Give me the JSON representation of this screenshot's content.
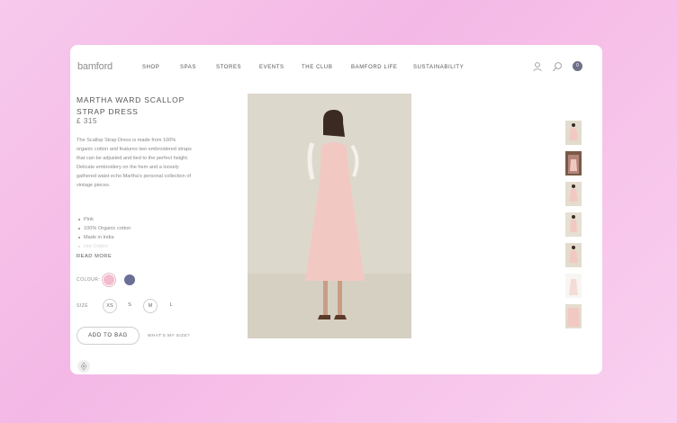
{
  "header": {
    "logo": "bamford",
    "nav": [
      "SHOP",
      "SPAS",
      "STORES",
      "EVENTS",
      "THE CLUB",
      "BAMFORD LIFE",
      "SUSTAINABILITY"
    ],
    "icons": [
      "user-icon",
      "search-icon"
    ],
    "bag_count": "0"
  },
  "product": {
    "title": "MARTHA WARD SCALLOP STRAP DRESS",
    "price": "£ 315",
    "description": "The Scallop Strap Dress is made from 100% organic cotton and features two embroidered straps that can be adjusted and tied to the perfect height. Delicate embroidery on the hem and a loosely gathered waist echo Martha's personal collection of vintage pieces.",
    "bullets": [
      "Pink",
      "100% Organic cotton",
      "Made in India",
      "Hot Cotton"
    ],
    "read_more": "READ MORE",
    "colour_label": "COLOUR:",
    "colours": [
      {
        "name": "pink",
        "hex": "#f3bccd"
      },
      {
        "name": "navy",
        "hex": "#6b6f96"
      }
    ],
    "size_label": "SIZE",
    "sizes": [
      "XS",
      "S",
      "M",
      "L"
    ],
    "add_to_bag": "ADD TO BAG",
    "whats_my_size": "WHAT'S MY SIZE?"
  },
  "colors": {
    "background_gradient": [
      "#f7c9ec",
      "#f4b8e6"
    ],
    "dress": "#f2c9c2",
    "photo_bg": "#ddd8cc"
  },
  "thumbnails": [
    "thumbnail-1",
    "thumbnail-2",
    "thumbnail-3",
    "thumbnail-4",
    "thumbnail-5",
    "thumbnail-6",
    "thumbnail-7"
  ]
}
